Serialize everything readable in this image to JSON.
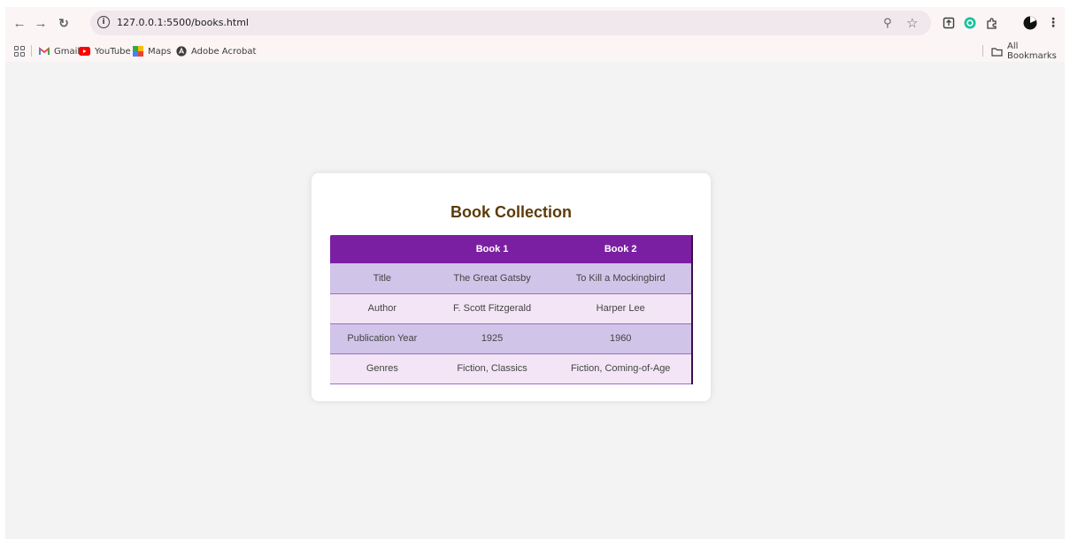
{
  "browser": {
    "url": "127.0.0.1:5500/books.html",
    "bookmarks": [
      {
        "label": "Gmail",
        "icon": "gmail-icon"
      },
      {
        "label": "YouTube",
        "icon": "youtube-icon"
      },
      {
        "label": "Maps",
        "icon": "maps-icon"
      },
      {
        "label": "Adobe Acrobat",
        "icon": "acrobat-icon"
      }
    ],
    "all_bookmarks_label": "All Bookmarks"
  },
  "page": {
    "title": "Book Collection",
    "columns": [
      "",
      "Book 1",
      "Book 2"
    ],
    "rows": [
      {
        "label": "Title",
        "book1": "The Great Gatsby",
        "book2": "To Kill a Mockingbird"
      },
      {
        "label": "Author",
        "book1": "F. Scott Fitzgerald",
        "book2": "Harper Lee"
      },
      {
        "label": "Publication Year",
        "book1": "1925",
        "book2": "1960"
      },
      {
        "label": "Genres",
        "book1": "Fiction, Classics",
        "book2": "Fiction, Coming-of-Age"
      }
    ]
  },
  "colors": {
    "header_bg": "#7b1fa2",
    "row_odd": "#d1c4e9",
    "row_even": "#f3e5f5",
    "title_color": "#5b3b0a"
  }
}
